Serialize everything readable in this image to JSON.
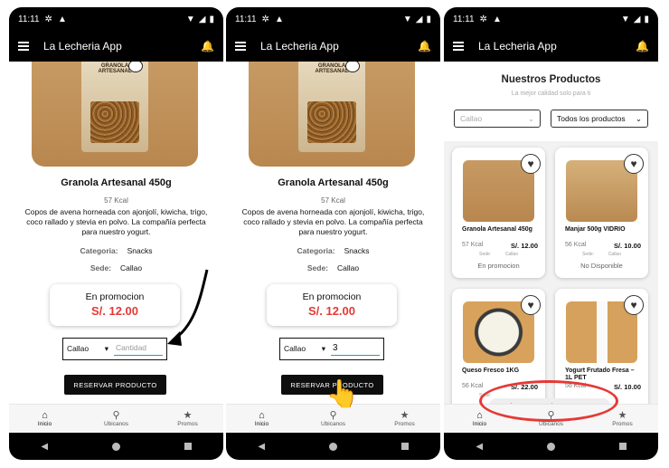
{
  "status": {
    "time": "11:11"
  },
  "app": {
    "title": "La Lecheria App"
  },
  "product": {
    "name": "Granola Artesanal 450g",
    "kcal": "57 Kcal",
    "description": "Copos de avena horneada con ajonjolí, kiwicha, trigo, coco rallado y stevia en polvo. La compañía perfecta para nuestro yogurt.",
    "category_label": "Categoria:",
    "category_value": "Snacks",
    "site_label": "Sede:",
    "site_value": "Callao",
    "promo_label": "En promocion",
    "price": "S/. 12.00",
    "bag_label": "GRANOLA ARTESANAL"
  },
  "order": {
    "site_selected": "Callao",
    "qty_placeholder": "Cantidad",
    "qty_value": "3",
    "reserve_label": "RESERVAR PRODUCTO"
  },
  "nav": {
    "home": "Inicio",
    "locations": "Ubicanos",
    "promos": "Promos"
  },
  "catalog": {
    "heading": "Nuestros Productos",
    "subheading": "La mejor calidad solo para ti",
    "filter_site": "Callao",
    "filter_products": "Todos los productos",
    "items": [
      {
        "name": "Granola Artesanal 450g",
        "kcal": "57 Kcal",
        "price": "S/. 12.00",
        "site_label": "Sede:",
        "site": "Callao",
        "status": "En promocion"
      },
      {
        "name": "Manjar 500g VIDRIO",
        "kcal": "56 Kcal",
        "price": "S/. 10.00",
        "site_label": "Sede:",
        "site": "Callao",
        "status": "No Disponible"
      },
      {
        "name": "Queso Fresco 1KG",
        "kcal": "56 Kcal",
        "price": "S/. 22.00",
        "site_label": "Sede:",
        "site": "",
        "status": ""
      },
      {
        "name": "Yogurt Frutado Fresa – 1L PET",
        "kcal": "56 Kcal",
        "price": "S/. 10.00",
        "site_label": "",
        "site": "",
        "status": ""
      }
    ],
    "toast": "Producto reservado correctamente"
  },
  "colors": {
    "accent_red": "#e53935",
    "appbar": "#000000",
    "underline": "#26a69a"
  },
  "icons": [
    "menu-icon",
    "bell-icon",
    "home-icon",
    "location-icon",
    "star-icon",
    "heart-icon",
    "dropdown-icon"
  ]
}
